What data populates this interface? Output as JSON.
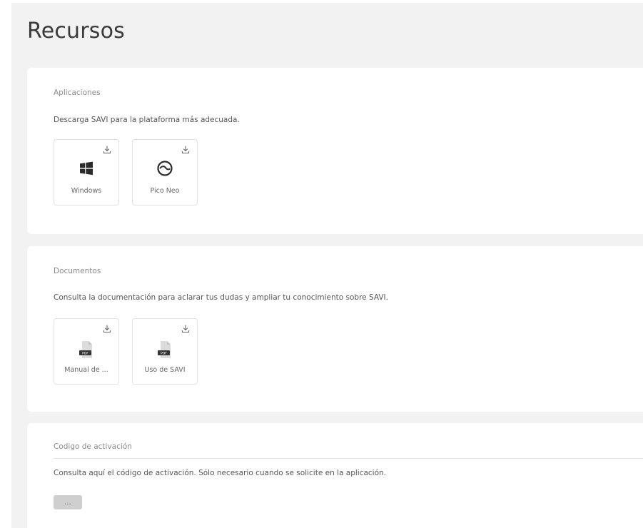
{
  "page": {
    "title": "Recursos"
  },
  "applications": {
    "title": "Aplicaciones",
    "description": "Descarga SAVI para la plataforma más adecuada.",
    "items": [
      {
        "label": "Windows",
        "icon": "windows-icon"
      },
      {
        "label": "Pico Neo",
        "icon": "pico-neo-icon"
      }
    ]
  },
  "documents": {
    "title": "Documentos",
    "description": "Consulta la documentación para aclarar tus dudas y ampliar tu conocimiento sobre SAVI.",
    "items": [
      {
        "label": "Manual de ...",
        "icon": "pdf-file-icon"
      },
      {
        "label": "Uso de SAVI",
        "icon": "pdf-file-icon"
      }
    ]
  },
  "activation": {
    "title": "Codigo de activación",
    "description": "Consulta aquí el código de activación. Sólo necesario cuando se solicite en la aplicación.",
    "button_label": "..."
  },
  "colors": {
    "page_background": "#f2f2f2",
    "card_background": "#ffffff",
    "icon_dark": "#2b2b2b",
    "button_gray": "#cfcfcf"
  }
}
